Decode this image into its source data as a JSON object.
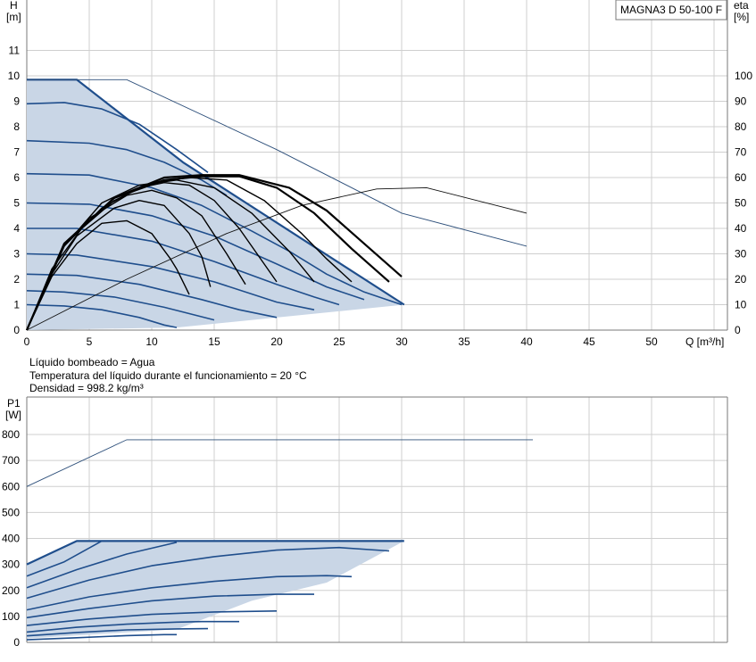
{
  "model_label": "MAGNA3 D 50-100 F",
  "notes": [
    "Líquido bombeado = Agua",
    "Temperatura del líquido durante el funcionamiento = 20 °C",
    "Densidad = 998.2 kg/m³"
  ],
  "colors": {
    "accent": "#1f4e8c",
    "fill": "#c9d6e6",
    "grid": "#cfcfcf",
    "efficiency": "#000000",
    "thin": "#2d4f7a"
  },
  "chart_data": [
    {
      "type": "line",
      "title": "",
      "xlabel": "Q [m³/h]",
      "ylabel": [
        "H",
        "[m]"
      ],
      "y2label": [
        "eta",
        "[%]"
      ],
      "xlim": [
        0,
        55
      ],
      "ylim": [
        0,
        12
      ],
      "y2lim": [
        0,
        120
      ],
      "x_ticks": [
        "0",
        "5",
        "10",
        "15",
        "20",
        "25",
        "30",
        "35",
        "40",
        "45",
        "50"
      ],
      "y_ticks": [
        "0",
        "1",
        "2",
        "3",
        "4",
        "5",
        "6",
        "7",
        "8",
        "9",
        "10",
        "11"
      ],
      "y2_ticks": [
        "0",
        "10",
        "20",
        "30",
        "40",
        "50",
        "60",
        "70",
        "80",
        "90",
        "100"
      ],
      "grid": true,
      "operating_area": [
        [
          0,
          9.85
        ],
        [
          4,
          9.85
        ],
        [
          12.5,
          6.6
        ],
        [
          30.2,
          1.0
        ],
        [
          12,
          0.1
        ],
        [
          0,
          0
        ]
      ],
      "thin_series": [
        {
          "kind": "head_max",
          "points": [
            [
              0,
              9.85
            ],
            [
              8,
              9.85
            ],
            [
              20,
              7.1
            ],
            [
              30,
              4.6
            ],
            [
              40,
              3.3
            ]
          ]
        },
        {
          "kind": "efficiency",
          "axis": "y2",
          "points": [
            [
              0,
              0
            ],
            [
              8,
              20
            ],
            [
              16,
              38
            ],
            [
              22,
              49
            ],
            [
              28,
              55.5
            ],
            [
              32,
              56
            ],
            [
              40,
              46
            ]
          ]
        }
      ],
      "head_curves": [
        {
          "points": [
            [
              0,
              9.85
            ],
            [
              4,
              9.85
            ],
            [
              12.5,
              6.6
            ],
            [
              30.2,
              1.0
            ]
          ]
        },
        {
          "points": [
            [
              0,
              8.9
            ],
            [
              3,
              8.95
            ],
            [
              6,
              8.7
            ],
            [
              9,
              8.1
            ],
            [
              12,
              7.1
            ],
            [
              14.5,
              6.2
            ]
          ]
        },
        {
          "points": [
            [
              0,
              7.45
            ],
            [
              5,
              7.35
            ],
            [
              8,
              7.1
            ],
            [
              11,
              6.6
            ],
            [
              14,
              5.9
            ],
            [
              16,
              5.3
            ]
          ]
        },
        {
          "points": [
            [
              0,
              6.15
            ],
            [
              5,
              6.1
            ],
            [
              10,
              5.6
            ],
            [
              14,
              4.9
            ],
            [
              18,
              3.9
            ],
            [
              21,
              3.1
            ],
            [
              24,
              2.2
            ],
            [
              27,
              1.5
            ],
            [
              30,
              1.0
            ]
          ]
        },
        {
          "points": [
            [
              0,
              5.0
            ],
            [
              5,
              4.95
            ],
            [
              10,
              4.5
            ],
            [
              15,
              3.7
            ],
            [
              20,
              2.6
            ],
            [
              24,
              1.7
            ],
            [
              27,
              1.2
            ]
          ]
        },
        {
          "points": [
            [
              0,
              4.0
            ],
            [
              4,
              4.0
            ],
            [
              10,
              3.5
            ],
            [
              15,
              2.7
            ],
            [
              20,
              1.8
            ],
            [
              23,
              1.3
            ],
            [
              25,
              1.0
            ]
          ]
        },
        {
          "points": [
            [
              0,
              3.0
            ],
            [
              4,
              2.95
            ],
            [
              10,
              2.5
            ],
            [
              15,
              1.9
            ],
            [
              20,
              1.1
            ],
            [
              23,
              0.8
            ]
          ]
        },
        {
          "points": [
            [
              0,
              2.2
            ],
            [
              4,
              2.15
            ],
            [
              9,
              1.8
            ],
            [
              14,
              1.2
            ],
            [
              17,
              0.8
            ],
            [
              20,
              0.5
            ]
          ]
        },
        {
          "points": [
            [
              0,
              1.55
            ],
            [
              3,
              1.5
            ],
            [
              7,
              1.3
            ],
            [
              11,
              0.9
            ],
            [
              15,
              0.4
            ]
          ]
        },
        {
          "points": [
            [
              0,
              1.0
            ],
            [
              3,
              0.95
            ],
            [
              6,
              0.8
            ],
            [
              9,
              0.5
            ],
            [
              11,
              0.2
            ],
            [
              12,
              0.1
            ]
          ]
        }
      ],
      "efficiency_curves": [
        {
          "points": [
            [
              0,
              0
            ],
            [
              2,
              2.1
            ],
            [
              4,
              3.4
            ],
            [
              6,
              4.2
            ],
            [
              8,
              4.3
            ],
            [
              10,
              3.8
            ],
            [
              11.5,
              2.8
            ],
            [
              12,
              2.4
            ],
            [
              13,
              1.4
            ]
          ]
        },
        {
          "points": [
            [
              0,
              0
            ],
            [
              2,
              2.2
            ],
            [
              4,
              3.7
            ],
            [
              7,
              4.8
            ],
            [
              9,
              5.1
            ],
            [
              11,
              4.9
            ],
            [
              13,
              3.8
            ],
            [
              14,
              2.9
            ],
            [
              14.7,
              1.7
            ]
          ]
        },
        {
          "points": [
            [
              0,
              0
            ],
            [
              2,
              2.4
            ],
            [
              5,
              4.4
            ],
            [
              8,
              5.3
            ],
            [
              10,
              5.5
            ],
            [
              12,
              5.2
            ],
            [
              14,
              4.5
            ],
            [
              16,
              3.0
            ],
            [
              17.5,
              1.8
            ]
          ]
        },
        {
          "points": [
            [
              0,
              0
            ],
            [
              3,
              3.3
            ],
            [
              6,
              4.8
            ],
            [
              9,
              5.6
            ],
            [
              11,
              5.8
            ],
            [
              13,
              5.7
            ],
            [
              15,
              5.1
            ],
            [
              17,
              4.0
            ],
            [
              19,
              2.6
            ],
            [
              20,
              1.9
            ]
          ]
        },
        {
          "points": [
            [
              0,
              0
            ],
            [
              3,
              3.3
            ],
            [
              6,
              5.0
            ],
            [
              9,
              5.7
            ],
            [
              12,
              5.9
            ],
            [
              15,
              5.6
            ],
            [
              18,
              4.6
            ],
            [
              21,
              3.1
            ],
            [
              23,
              1.9
            ]
          ]
        },
        {
          "points": [
            [
              0,
              0
            ],
            [
              3,
              3.4
            ],
            [
              7,
              5.1
            ],
            [
              10,
              5.8
            ],
            [
              13,
              6.0
            ],
            [
              16,
              5.9
            ],
            [
              19,
              5.1
            ],
            [
              22,
              3.8
            ],
            [
              24,
              2.8
            ],
            [
              26,
              1.9
            ]
          ]
        },
        {
          "points": [
            [
              0,
              0
            ],
            [
              3,
              3.4
            ],
            [
              7,
              5.2
            ],
            [
              11,
              5.9
            ],
            [
              14,
              6.05
            ],
            [
              17,
              6.05
            ],
            [
              20,
              5.6
            ],
            [
              23,
              4.6
            ],
            [
              26,
              3.2
            ],
            [
              29,
              1.9
            ]
          ]
        },
        {
          "points": [
            [
              0,
              0
            ],
            [
              3,
              3.4
            ],
            [
              7,
              5.2
            ],
            [
              11,
              6.0
            ],
            [
              14,
              6.1
            ],
            [
              17,
              6.1
            ],
            [
              21,
              5.6
            ],
            [
              24,
              4.7
            ],
            [
              27,
              3.4
            ],
            [
              30,
              2.1
            ]
          ]
        }
      ]
    },
    {
      "type": "line",
      "title": "",
      "xlabel": "",
      "ylabel": [
        "P1",
        "[W]"
      ],
      "xlim": [
        0,
        55
      ],
      "ylim": [
        0,
        800
      ],
      "y_ticks": [
        "0",
        "100",
        "200",
        "300",
        "400",
        "500",
        "600",
        "700",
        "800"
      ],
      "grid": true,
      "operating_area": [
        [
          0,
          300
        ],
        [
          4,
          390
        ],
        [
          30.2,
          390
        ],
        [
          24,
          230
        ],
        [
          18,
          160
        ],
        [
          12,
          50
        ],
        [
          0,
          15
        ]
      ],
      "thin_series": [
        {
          "kind": "power_max",
          "points": [
            [
              0,
              600
            ],
            [
              8,
              780
            ],
            [
              40.5,
              780
            ]
          ]
        }
      ],
      "power_curves": [
        {
          "points": [
            [
              0,
              300
            ],
            [
              4,
              390
            ],
            [
              30.2,
              390
            ]
          ]
        },
        {
          "points": [
            [
              0,
              255
            ],
            [
              3,
              310
            ],
            [
              6,
              390
            ]
          ]
        },
        {
          "points": [
            [
              0,
              210
            ],
            [
              4,
              280
            ],
            [
              8,
              340
            ],
            [
              12,
              385
            ]
          ]
        },
        {
          "points": [
            [
              0,
              170
            ],
            [
              5,
              240
            ],
            [
              10,
              295
            ],
            [
              15,
              330
            ],
            [
              20,
              355
            ],
            [
              25,
              365
            ],
            [
              29,
              352
            ]
          ]
        },
        {
          "points": [
            [
              0,
              125
            ],
            [
              5,
              175
            ],
            [
              10,
              210
            ],
            [
              15,
              235
            ],
            [
              20,
              253
            ],
            [
              24,
              257
            ],
            [
              26,
              253
            ]
          ]
        },
        {
          "points": [
            [
              0,
              95
            ],
            [
              5,
              130
            ],
            [
              10,
              160
            ],
            [
              15,
              178
            ],
            [
              20,
              185
            ],
            [
              23,
              185
            ]
          ]
        },
        {
          "points": [
            [
              0,
              65
            ],
            [
              5,
              90
            ],
            [
              10,
              108
            ],
            [
              15,
              117
            ],
            [
              20,
              121
            ]
          ]
        },
        {
          "points": [
            [
              0,
              40
            ],
            [
              4,
              58
            ],
            [
              8,
              70
            ],
            [
              12,
              78
            ],
            [
              14,
              80
            ],
            [
              17,
              80
            ]
          ]
        },
        {
          "points": [
            [
              0,
              25
            ],
            [
              4,
              38
            ],
            [
              8,
              48
            ],
            [
              12,
              52
            ],
            [
              14.5,
              53
            ]
          ]
        },
        {
          "points": [
            [
              0,
              10
            ],
            [
              4,
              18
            ],
            [
              8,
              26
            ],
            [
              11,
              30
            ],
            [
              12,
              30
            ]
          ]
        }
      ]
    }
  ]
}
